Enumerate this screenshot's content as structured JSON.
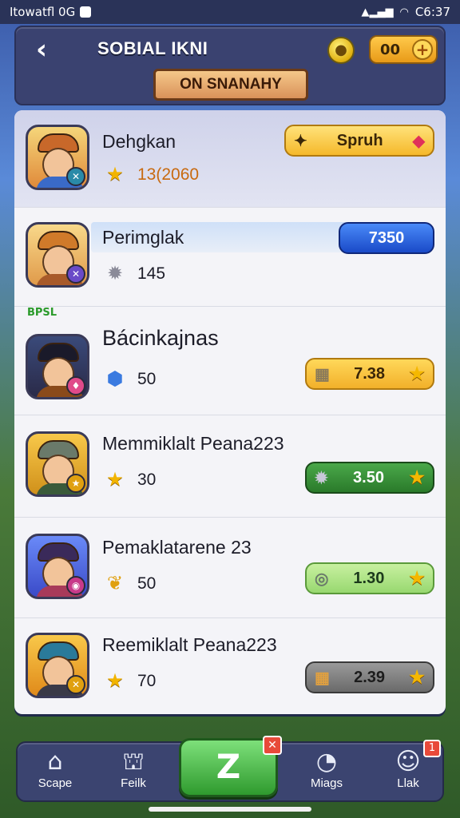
{
  "status_bar": {
    "left_text": "Itowatfl 0G",
    "time": "C6:37"
  },
  "header": {
    "title": "SOBIAL IKNI",
    "counter_value": "00",
    "counter_plus": "+",
    "banner_text": "ON SNANAHY"
  },
  "mini_tag": "BPSL",
  "rows": [
    {
      "name": "Dehgkan",
      "stat_value": "13(2060",
      "stat_icon": "star-icon",
      "pill_text": "Spruh",
      "pill_color": "#ffcc2e"
    },
    {
      "name": "Perimglak",
      "stat_value": "145",
      "stat_icon": "gear-icon",
      "pill_text": "7350",
      "pill_color": "#2a6ae8"
    },
    {
      "name": "Bácinkajnas",
      "stat_value": "50",
      "stat_icon": "gem-icon",
      "pill_text": "7.38",
      "pill_color": "#f6c13a"
    },
    {
      "name": "Memmiklalt Peana223",
      "stat_value": "30",
      "stat_icon": "star-icon",
      "pill_text": "3.50",
      "pill_color": "#3e9a3a"
    },
    {
      "name": "Pemaklatarene 23",
      "stat_value": "50",
      "stat_icon": "leaf-icon",
      "pill_text": "1.30",
      "pill_color": "#a8e07a"
    },
    {
      "name": "Reemiklalt Peana223",
      "stat_value": "70",
      "stat_icon": "star-icon",
      "pill_text": "2.39",
      "pill_color": "#7a7a7a"
    }
  ],
  "nav": {
    "items": [
      {
        "label": "Scape",
        "icon": "home-icon"
      },
      {
        "label": "Feilk",
        "icon": "shop-icon"
      },
      {
        "label": "Miags",
        "icon": "chat-icon"
      },
      {
        "label": "Llak",
        "icon": "profile-icon"
      }
    ],
    "center_label": "Z",
    "center_badge": "✕",
    "profile_badge": "1"
  }
}
